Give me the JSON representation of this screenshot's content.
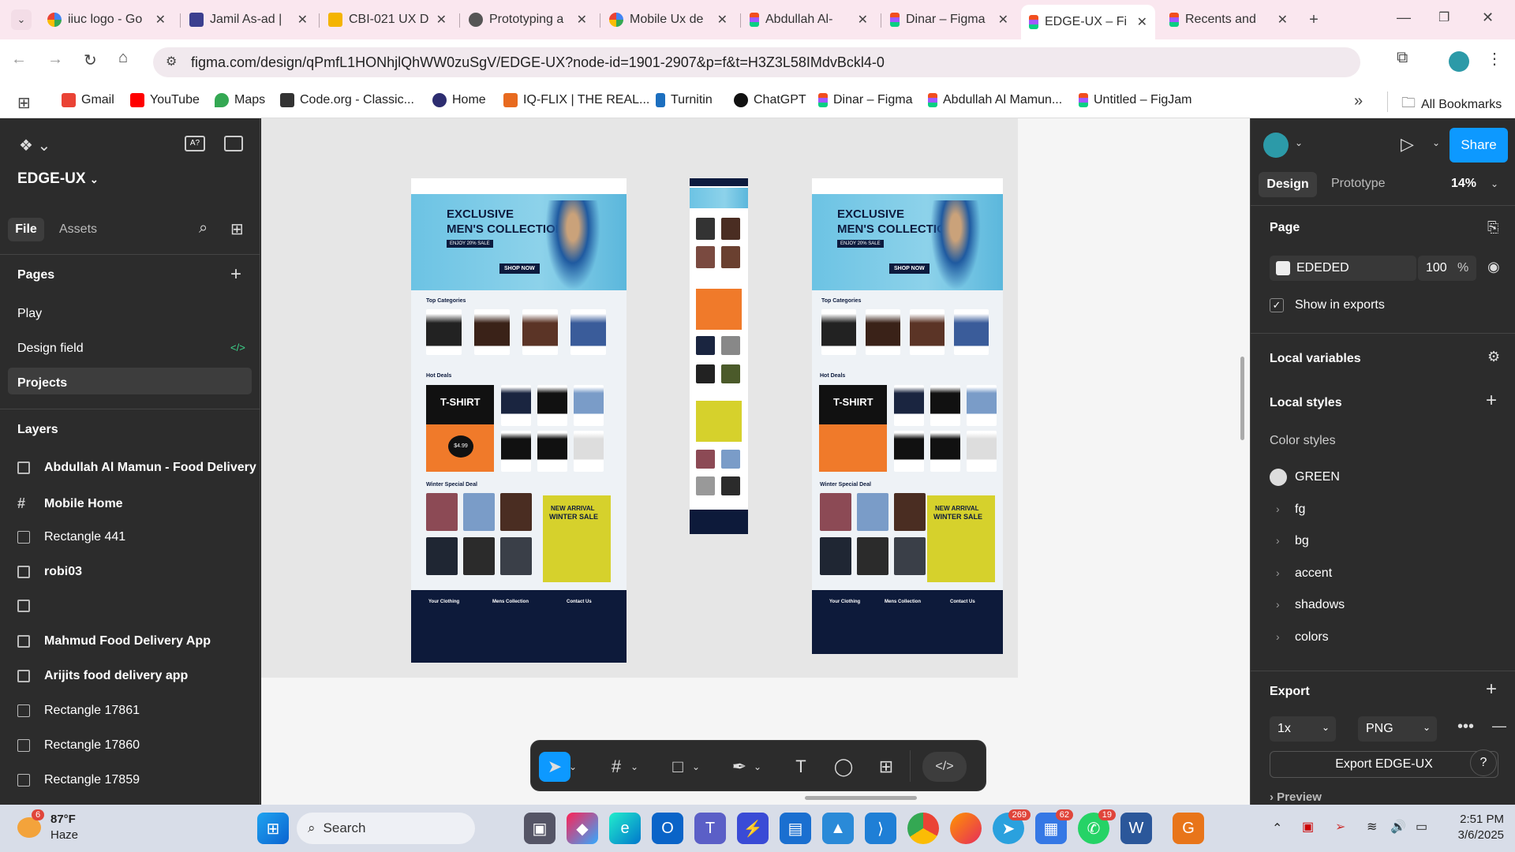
{
  "browser": {
    "tabs": [
      {
        "label": "iiuc logo - Go",
        "icon": "google-icon"
      },
      {
        "label": "Jamil As-ad |",
        "icon": "shield-icon"
      },
      {
        "label": "CBI-021 UX D",
        "icon": "slides-icon"
      },
      {
        "label": "Prototyping a",
        "icon": "globe-icon"
      },
      {
        "label": "Mobile Ux de",
        "icon": "google-icon"
      },
      {
        "label": "Abdullah Al-",
        "icon": "figma-icon"
      },
      {
        "label": "Dinar – Figma",
        "icon": "figma-icon"
      },
      {
        "label": "EDGE-UX – Fi",
        "icon": "figma-icon",
        "active": true
      },
      {
        "label": "Recents and",
        "icon": "figma-icon"
      }
    ],
    "url": "figma.com/design/qPmfL1HONhjlQhWW0zuSgV/EDGE-UX?node-id=1901-2907&p=f&t=H3Z3L58IMdvBckl4-0",
    "bookmarks": [
      {
        "label": "Gmail"
      },
      {
        "label": "YouTube"
      },
      {
        "label": "Maps"
      },
      {
        "label": "Code.org - Classic..."
      },
      {
        "label": "Home"
      },
      {
        "label": "IQ-FLIX | THE REAL..."
      },
      {
        "label": "Turnitin"
      },
      {
        "label": "ChatGPT"
      },
      {
        "label": "Dinar – Figma"
      },
      {
        "label": "Abdullah Al Mamun..."
      },
      {
        "label": "Untitled – FigJam"
      }
    ],
    "all_bookmarks": "All Bookmarks"
  },
  "left": {
    "file_name": "EDGE-UX",
    "tabs": {
      "file": "File",
      "assets": "Assets"
    },
    "pages_title": "Pages",
    "pages": [
      "Play",
      "Design field",
      "Projects"
    ],
    "layers_title": "Layers",
    "layers": [
      {
        "label": "Abdullah Al Mamun - Food Delivery A",
        "icon": "frame-icon"
      },
      {
        "label": "Mobile Home",
        "icon": "hash-icon"
      },
      {
        "label": "Rectangle 441",
        "icon": "rect-icon"
      },
      {
        "label": "robi03",
        "icon": "frame-icon"
      },
      {
        "label": "",
        "icon": "frame-icon"
      },
      {
        "label": "Mahmud Food Delivery App",
        "icon": "frame-icon"
      },
      {
        "label": "Arijits food delivery app",
        "icon": "frame-icon"
      },
      {
        "label": "Rectangle 17861",
        "icon": "rect-icon"
      },
      {
        "label": "Rectangle 17860",
        "icon": "rect-icon"
      },
      {
        "label": "Rectangle 17859",
        "icon": "rect-icon"
      }
    ]
  },
  "design": {
    "hero_title_1": "EXCLUSIVE",
    "hero_title_2": "MEN'S COLLECTION",
    "hero_badge": "ENJOY 20% SALE",
    "shop_now": "SHOP NOW",
    "top_categories": "Top Categories",
    "hot_deals": "Hot Deals",
    "winter_deal": "Winter Special Deal",
    "tshirt": "T-SHIRT",
    "price": "$4.99",
    "new_arrival": "NEW ARRIVAL",
    "winter_sale": "WINTER SALE",
    "brand": "Your Clothing",
    "mens_collection": "Mens Collection",
    "contact": "Contact Us"
  },
  "right": {
    "tabs": {
      "design": "Design",
      "prototype": "Prototype"
    },
    "zoom": "14%",
    "share": "Share",
    "page_title": "Page",
    "page_color": "EDEDED",
    "page_opacity": "100",
    "percent": "%",
    "show_exports": "Show in exports",
    "local_variables": "Local variables",
    "local_styles": "Local styles",
    "color_styles": "Color styles",
    "styles": [
      "GREEN",
      "fg",
      "bg",
      "accent",
      "shadows",
      "colors"
    ],
    "export_title": "Export",
    "export_scale": "1x",
    "export_format": "PNG",
    "export_button": "Export EDGE-UX",
    "preview": "Preview"
  },
  "taskbar": {
    "weather_temp": "87°F",
    "weather_desc": "Haze",
    "weather_badge": "6",
    "search": "Search",
    "badge_telegram": "269",
    "badge_teams": "62",
    "badge_whatsapp": "19",
    "time": "2:51 PM",
    "date": "3/6/2025"
  }
}
